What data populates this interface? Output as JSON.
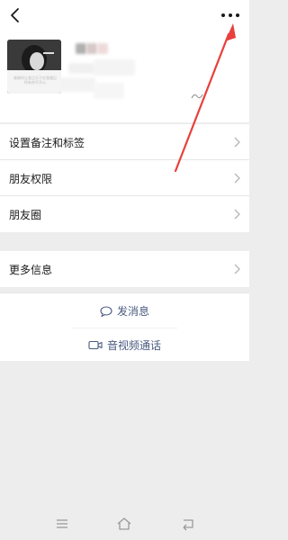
{
  "header": {
    "back_icon": "chevron-left-icon",
    "more_icon": "more-horizontal-icon"
  },
  "profile": {
    "avatar_caption": "感谢你让我之乐于在我遇见所有的不开心"
  },
  "menu_group_1": [
    {
      "label": "设置备注和标签",
      "icon": "chevron-right-icon"
    },
    {
      "label": "朋友权限",
      "icon": "chevron-right-icon"
    },
    {
      "label": "朋友圈",
      "icon": "chevron-right-icon"
    }
  ],
  "menu_group_2": [
    {
      "label": "更多信息",
      "icon": "chevron-right-icon"
    }
  ],
  "actions": {
    "message_label": "发消息",
    "message_icon": "chat-bubble-icon",
    "call_label": "音视频通话",
    "call_icon": "video-camera-icon"
  },
  "navbar": {
    "icons": [
      "menu-icon",
      "home-icon",
      "back-icon"
    ]
  },
  "colors": {
    "accent": "#4a5a80",
    "annotation": "#e8403c"
  }
}
